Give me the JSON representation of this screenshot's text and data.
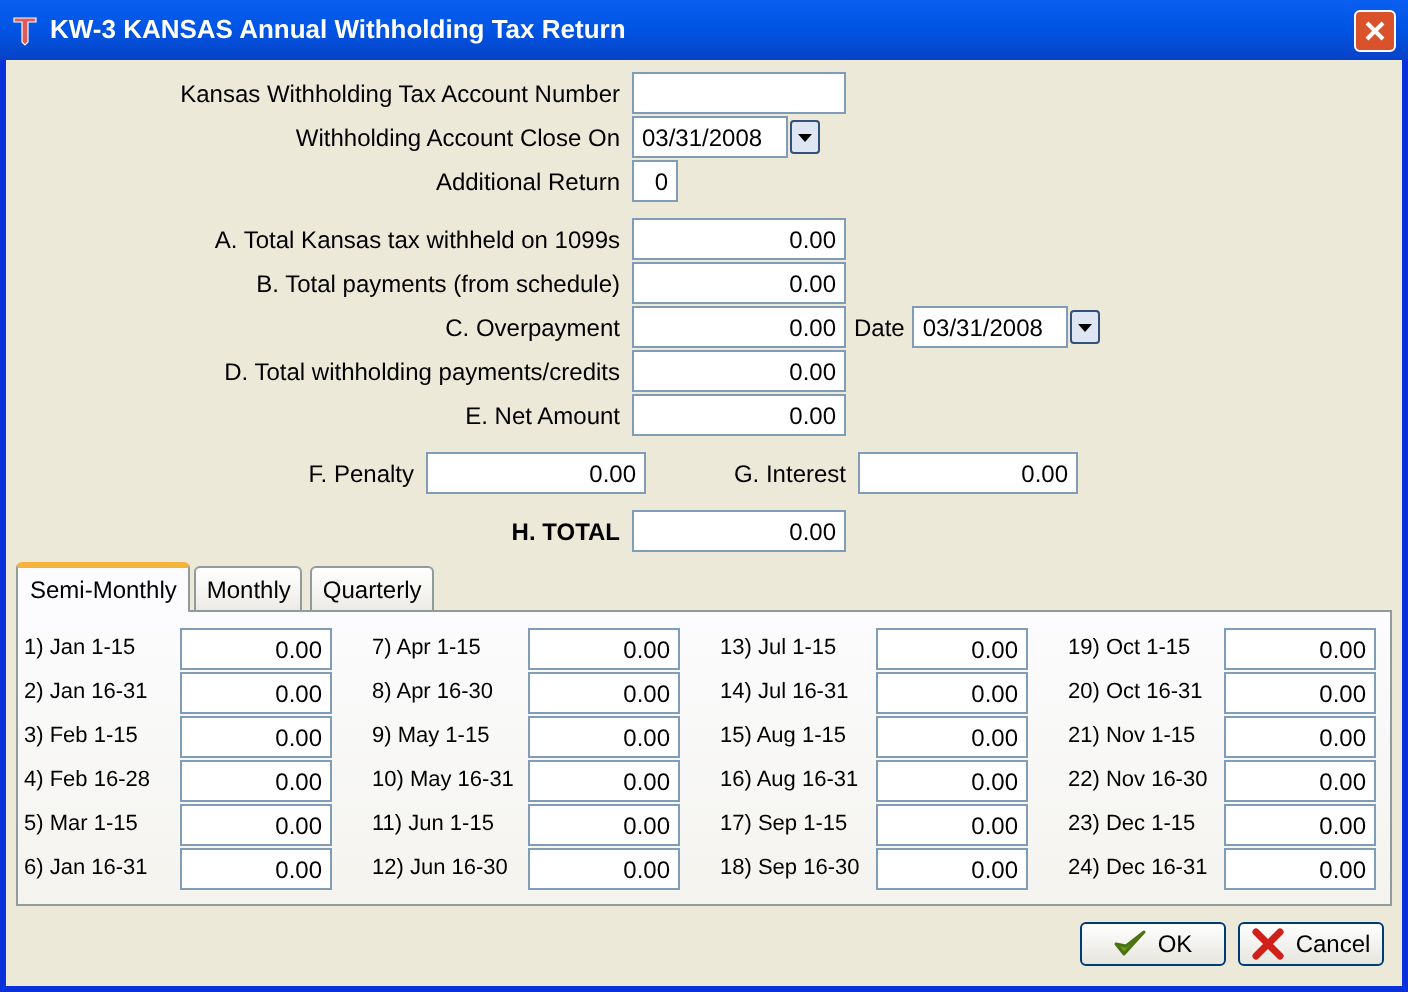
{
  "window": {
    "title": "KW-3  KANSAS Annual Withholding Tax Return"
  },
  "account_number": {
    "label": "Kansas Withholding Tax Account Number"
  },
  "close_on": {
    "label": "Withholding Account Close On",
    "value": "03/31/2008"
  },
  "additional_return": {
    "label": "Additional Return",
    "value": "0"
  },
  "lines": [
    {
      "label": "A. Total Kansas tax withheld on 1099s",
      "value": "0.00"
    },
    {
      "label": "B. Total payments (from schedule)",
      "value": "0.00"
    },
    {
      "label": "C. Overpayment",
      "value": "0.00",
      "date_label": "Date",
      "date_value": "03/31/2008"
    },
    {
      "label": "D. Total withholding payments/credits",
      "value": "0.00"
    },
    {
      "label": "E. Net Amount",
      "value": "0.00"
    }
  ],
  "penalty": {
    "label": "F. Penalty",
    "value": "0.00"
  },
  "interest": {
    "label": "G. Interest",
    "value": "0.00"
  },
  "total": {
    "label": "H. TOTAL",
    "value": "0.00"
  },
  "tabs": [
    {
      "label": "Semi-Monthly",
      "selected": true
    },
    {
      "label": "Monthly",
      "selected": false
    },
    {
      "label": "Quarterly",
      "selected": false
    }
  ],
  "periods": [
    {
      "label": "1) Jan 1-15",
      "value": "0.00"
    },
    {
      "label": "2) Jan 16-31",
      "value": "0.00"
    },
    {
      "label": "3) Feb 1-15",
      "value": "0.00"
    },
    {
      "label": "4) Feb 16-28",
      "value": "0.00"
    },
    {
      "label": "5) Mar 1-15",
      "value": "0.00"
    },
    {
      "label": "6) Jan 16-31",
      "value": "0.00"
    },
    {
      "label": "7) Apr 1-15",
      "value": "0.00"
    },
    {
      "label": "8) Apr 16-30",
      "value": "0.00"
    },
    {
      "label": "9) May 1-15",
      "value": "0.00"
    },
    {
      "label": "10) May 16-31",
      "value": "0.00"
    },
    {
      "label": "11) Jun 1-15",
      "value": "0.00"
    },
    {
      "label": "12) Jun 16-30",
      "value": "0.00"
    },
    {
      "label": "13) Jul 1-15",
      "value": "0.00"
    },
    {
      "label": "14) Jul 16-31",
      "value": "0.00"
    },
    {
      "label": "15) Aug 1-15",
      "value": "0.00"
    },
    {
      "label": "16) Aug 16-31",
      "value": "0.00"
    },
    {
      "label": "17) Sep 1-15",
      "value": "0.00"
    },
    {
      "label": "18) Sep 16-30",
      "value": "0.00"
    },
    {
      "label": "19) Oct 1-15",
      "value": "0.00"
    },
    {
      "label": "20) Oct 16-31",
      "value": "0.00"
    },
    {
      "label": "21) Nov 1-15",
      "value": "0.00"
    },
    {
      "label": "22) Nov 16-30",
      "value": "0.00"
    },
    {
      "label": "23) Dec 1-15",
      "value": "0.00"
    },
    {
      "label": "24) Dec 16-31",
      "value": "0.00"
    }
  ],
  "buttons": [
    {
      "kind": "ok",
      "label": "OK"
    },
    {
      "kind": "cancel",
      "label": "Cancel"
    }
  ]
}
